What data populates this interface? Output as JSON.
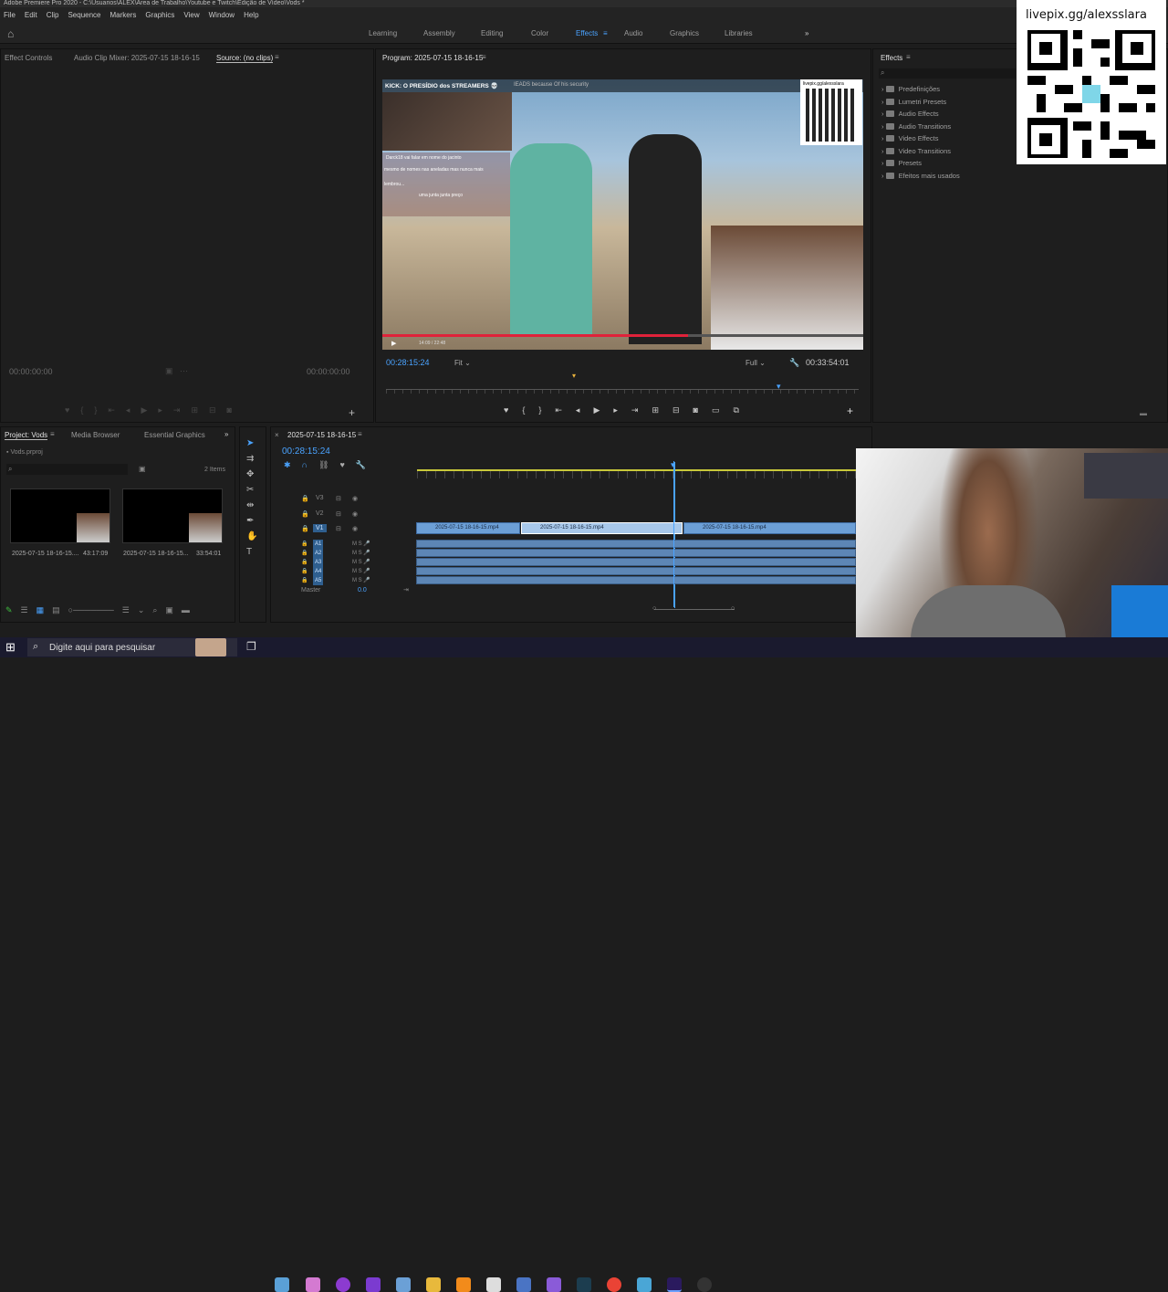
{
  "window": {
    "title": "Adobe Premiere Pro 2020 - C:\\Usuarios\\ALEX\\Area de Trabalho\\Youtube e Twitch\\Edição de Vídeo\\Vods *"
  },
  "menu": [
    "File",
    "Edit",
    "Clip",
    "Sequence",
    "Markers",
    "Graphics",
    "View",
    "Window",
    "Help"
  ],
  "workspaces": {
    "learning": "Learning",
    "assembly": "Assembly",
    "editing": "Editing",
    "color": "Color",
    "effects": "Effects",
    "audio": "Audio",
    "graphics": "Graphics",
    "libraries": "Libraries",
    "more": "»"
  },
  "source_panel": {
    "tab_effect_controls": "Effect Controls",
    "tab_audio_mixer": "Audio Clip Mixer: 2025-07-15 18-16-15",
    "tab_source": "Source: (no clips)",
    "tc_in": "00:00:00:00",
    "tc_out": "00:00:00:00"
  },
  "program": {
    "tab": "Program: 2025-07-15 18-16-15",
    "timecode": "00:28:15:24",
    "fit": "Fit",
    "quality": "Full",
    "duration": "00:33:54:01",
    "video_overlay_title": "KICK: O PRESÍDIO dos STREAMERS 💀",
    "video_overlay_sub": "IEADS because Of his security",
    "video_qr_label": "livepix.gg/alexsslara",
    "video_chat_line1": "Darck18  vai falar em nome do jacinto",
    "video_chat_line2": "mesmo de nomes nas aneladas mas nunca mais",
    "video_chat_line3": "lembrou...",
    "video_chat_line4": "uma junta junta preço",
    "video_player_time": "14:09 / 22:48"
  },
  "effects_panel": {
    "tab": "Effects",
    "items": [
      "Predefinições",
      "Lumetri Presets",
      "Audio Effects",
      "Audio Transitions",
      "Video Effects",
      "Video Transitions",
      "Presets",
      "Efeitos mais usados"
    ]
  },
  "project_panel": {
    "tab_project": "Project: Vods",
    "tab_media_browser": "Media Browser",
    "tab_essential": "Essential Graphics",
    "file": "Vods.prproj",
    "count": "2 Items",
    "clips": [
      {
        "name": "2025-07-15 18-16-15....",
        "duration": "43:17:09"
      },
      {
        "name": "2025-07-15 18-16-15...",
        "duration": "33:54:01"
      }
    ]
  },
  "timeline": {
    "tab": "2025-07-15 18-16-15",
    "timecode": "00:28:15:24",
    "video_tracks": [
      "V3",
      "V2",
      "V1"
    ],
    "audio_tracks": [
      "A1",
      "A2",
      "A3",
      "A4",
      "A5"
    ],
    "master": "Master",
    "master_value": "0.0",
    "clips": [
      "2025-07-15 18-16-15.mp4",
      "2025-07-15 18-16-15.mp4",
      "2025-07-15 18-16-15.mp4"
    ]
  },
  "overlay": {
    "livepix": "livepix.gg/alexsslara"
  },
  "taskbar": {
    "search_placeholder": "Digite aqui para pesquisar"
  },
  "colors": {
    "accent": "#4aa3ff",
    "clip": "#6c9fd6",
    "bg": "#1d1d1d"
  }
}
